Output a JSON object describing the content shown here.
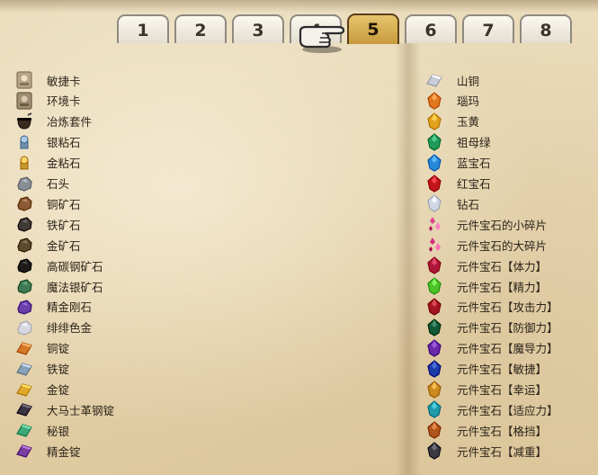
{
  "tabs": [
    {
      "label": "1",
      "active": false
    },
    {
      "label": "2",
      "active": false
    },
    {
      "label": "3",
      "active": false
    },
    {
      "label": "4",
      "active": false
    },
    {
      "label": "5",
      "active": true
    },
    {
      "label": "6",
      "active": false
    },
    {
      "label": "7",
      "active": false
    },
    {
      "label": "8",
      "active": false
    }
  ],
  "left_items": [
    {
      "label": "敏捷卡",
      "icon": "card-icon",
      "color": "#b8a48a"
    },
    {
      "label": "环境卡",
      "icon": "card-icon",
      "color": "#9f8d74"
    },
    {
      "label": "冶炼套件",
      "icon": "smelting-kit-icon",
      "color": "#3a2a1e"
    },
    {
      "label": "银粘石",
      "icon": "silver-flux-icon",
      "color": "#6f8fb0"
    },
    {
      "label": "金粘石",
      "icon": "gold-flux-icon",
      "color": "#c9962e"
    },
    {
      "label": "石头",
      "icon": "stone-icon",
      "color": "#8a8f96"
    },
    {
      "label": "铜矿石",
      "icon": "copper-ore-icon",
      "color": "#8a5a34"
    },
    {
      "label": "铁矿石",
      "icon": "iron-ore-icon",
      "color": "#3f3a36"
    },
    {
      "label": "金矿石",
      "icon": "gold-ore-icon",
      "color": "#5c4a2c"
    },
    {
      "label": "高碳钢矿石",
      "icon": "carbon-steel-ore-icon",
      "color": "#1e1b1a"
    },
    {
      "label": "魔法银矿石",
      "icon": "mythril-ore-icon",
      "color": "#3e7a54"
    },
    {
      "label": "精金刚石",
      "icon": "adamantite-icon",
      "color": "#6a3fa8"
    },
    {
      "label": "绯绯色金",
      "icon": "orichalcum-icon",
      "color": "#d8d8e4"
    },
    {
      "label": "铜锭",
      "icon": "copper-ingot-icon",
      "color": "#d5782a"
    },
    {
      "label": "铁锭",
      "icon": "iron-ingot-icon",
      "color": "#8aa2b8"
    },
    {
      "label": "金锭",
      "icon": "gold-ingot-icon",
      "color": "#e0a82a"
    },
    {
      "label": "大马士革钢锭",
      "icon": "damascus-ingot-icon",
      "color": "#3b3442"
    },
    {
      "label": "秘银",
      "icon": "mythril-ingot-icon",
      "color": "#3fa878"
    },
    {
      "label": "精金锭",
      "icon": "adamantite-ingot-icon",
      "color": "#7a3fa0"
    }
  ],
  "right_items": [
    {
      "label": "山铜",
      "icon": "orichalcum-ingot-icon",
      "color": "#c8ccd6"
    },
    {
      "label": "瑙玛",
      "icon": "agate-icon",
      "color": "#e0761e"
    },
    {
      "label": "玉黄",
      "icon": "topaz-icon",
      "color": "#e2a11c"
    },
    {
      "label": "祖母绿",
      "icon": "emerald-icon",
      "color": "#1f9a5a"
    },
    {
      "label": "蓝宝石",
      "icon": "sapphire-icon",
      "color": "#2a86d8"
    },
    {
      "label": "红宝石",
      "icon": "ruby-icon",
      "color": "#c4141c"
    },
    {
      "label": "钻石",
      "icon": "diamond-icon",
      "color": "#cfd6e4"
    },
    {
      "label": "元件宝石的小碎片",
      "icon": "small-shard-icon",
      "color": "#e0428a"
    },
    {
      "label": "元件宝石的大碎片",
      "icon": "large-shard-icon",
      "color": "#d42e7a"
    },
    {
      "label": "元件宝石【体力】",
      "icon": "gem-vitality-icon",
      "color": "#b0163a"
    },
    {
      "label": "元件宝石【精力】",
      "icon": "gem-spirit-icon",
      "color": "#4ec22a"
    },
    {
      "label": "元件宝石【攻击力】",
      "icon": "gem-attack-icon",
      "color": "#a41424"
    },
    {
      "label": "元件宝石【防御力】",
      "icon": "gem-defense-icon",
      "color": "#0f5a38"
    },
    {
      "label": "元件宝石【魔导力】",
      "icon": "gem-magic-icon",
      "color": "#6a2aa8"
    },
    {
      "label": "元件宝石【敏捷】",
      "icon": "gem-agility-icon",
      "color": "#1c3aa8"
    },
    {
      "label": "元件宝石【幸运】",
      "icon": "gem-luck-icon",
      "color": "#c98a1e"
    },
    {
      "label": "元件宝石【适应力】",
      "icon": "gem-adapt-icon",
      "color": "#1e9aa8"
    },
    {
      "label": "元件宝石【格挡】",
      "icon": "gem-block-icon",
      "color": "#b0561c"
    },
    {
      "label": "元件宝石【减重】",
      "icon": "gem-weight-icon",
      "color": "#3a3a44"
    }
  ],
  "pointer_icon": "hand-pointer-icon"
}
